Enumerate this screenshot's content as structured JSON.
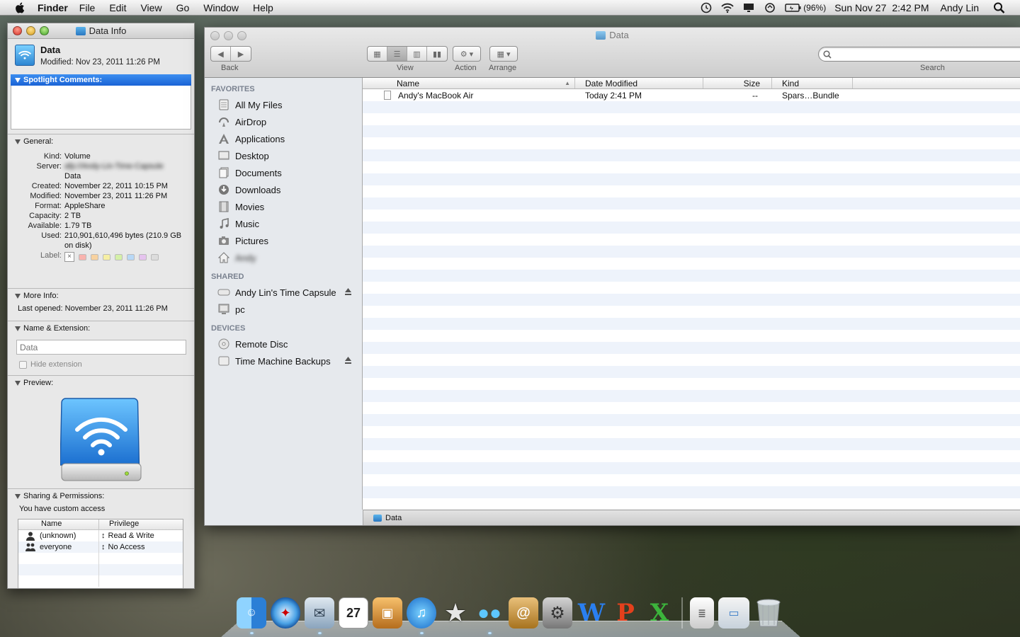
{
  "menubar": {
    "app": "Finder",
    "items": [
      "File",
      "Edit",
      "View",
      "Go",
      "Window",
      "Help"
    ],
    "battery": "(96%)",
    "date": "Sun Nov 27",
    "time": "2:42 PM",
    "user": "Andy Lin"
  },
  "info": {
    "title": "Data Info",
    "name": "Data",
    "modified": "Modified: Nov 23, 2011 11:26 PM",
    "spotlight": "Spotlight Comments:",
    "general": {
      "header": "General:",
      "rows": [
        {
          "k": "Kind:",
          "v": "Volume"
        },
        {
          "k": "Server:",
          "v": "afp://Andy-Lin-Time-Capsule"
        },
        {
          "k": "",
          "v": "Data"
        },
        {
          "k": "Created:",
          "v": "November 22, 2011 10:15 PM"
        },
        {
          "k": "Modified:",
          "v": "November 23, 2011 11:26 PM"
        },
        {
          "k": "Format:",
          "v": "AppleShare"
        },
        {
          "k": "Capacity:",
          "v": "2 TB"
        },
        {
          "k": "Available:",
          "v": "1.79 TB"
        },
        {
          "k": "Used:",
          "v": "210,901,610,496 bytes (210.9 GB on disk)"
        }
      ],
      "label": "Label:"
    },
    "more_info": {
      "header": "More Info:",
      "last_opened": "Last opened: November 23, 2011 11:26 PM"
    },
    "name_ext": {
      "header": "Name & Extension:",
      "placeholder": "Data",
      "hide": "Hide extension"
    },
    "preview": {
      "header": "Preview:"
    },
    "sharing": {
      "header": "Sharing & Permissions:",
      "text": "You have custom access",
      "col_name": "Name",
      "col_priv": "Privilege",
      "rows": [
        {
          "name": "(unknown)",
          "priv": "Read & Write"
        },
        {
          "name": "everyone",
          "priv": "No Access"
        }
      ]
    }
  },
  "finder": {
    "title": "Data",
    "toolbar": {
      "back": "Back",
      "view": "View",
      "action": "Action",
      "arrange": "Arrange",
      "search": "Search"
    },
    "sidebar": {
      "favorites_h": "FAVORITES",
      "favorites": [
        "All My Files",
        "AirDrop",
        "Applications",
        "Desktop",
        "Documents",
        "Downloads",
        "Movies",
        "Music",
        "Pictures",
        "Andy"
      ],
      "shared_h": "SHARED",
      "shared": [
        "Andy Lin's Time Capsule",
        "pc"
      ],
      "devices_h": "DEVICES",
      "devices": [
        "Remote Disc",
        "Time Machine Backups"
      ]
    },
    "columns": {
      "name": "Name",
      "date": "Date Modified",
      "size": "Size",
      "kind": "Kind"
    },
    "rows": [
      {
        "name": "Andy's MacBook Air",
        "date": "Today 2:41 PM",
        "size": "--",
        "kind": "Spars…Bundle"
      }
    ],
    "status": "Data"
  },
  "dock": [
    "Finder",
    "Safari",
    "Mail",
    "iCal",
    "iPhoto",
    "iTunes",
    "iMovie",
    "Messenger",
    "Address Book",
    "System Preferences",
    "Word",
    "PowerPoint",
    "Excel",
    "Documents",
    "Downloads",
    "Trash"
  ]
}
